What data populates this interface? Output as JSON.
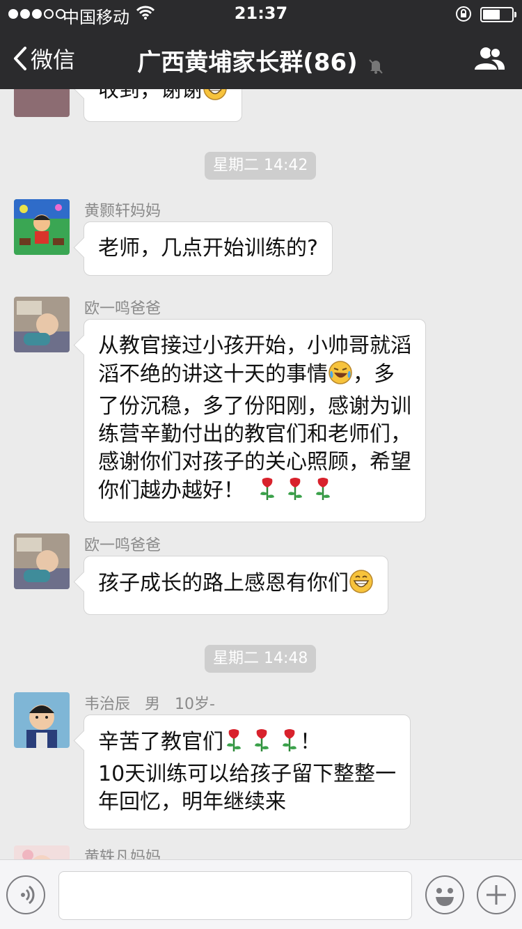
{
  "status_bar": {
    "carrier": "中国移动",
    "time": "21:37",
    "battery_level": 0.6
  },
  "nav": {
    "back_label": "微信",
    "title": "广西黄埔家长群(86)",
    "icons": [
      "back-chevron-icon",
      "mute-bell-icon",
      "group-members-icon"
    ]
  },
  "messages": [
    {
      "type": "text",
      "sender": "",
      "lines": [
        "收到，谢谢"
      ],
      "emoji_end": "grin"
    },
    {
      "type": "time",
      "text": "星期二 14:42"
    },
    {
      "type": "text",
      "sender": "黄颢轩妈妈",
      "lines": [
        "老师，几点开始训练的?"
      ]
    },
    {
      "type": "text",
      "sender": "欧一鸣爸爸",
      "lines": [
        "从教官接过小孩开始，小帅哥就滔",
        "滔不绝的讲这十天的事情",
        "，多",
        "了份沉稳，多了份阳刚，感谢为训",
        "练营辛勤付出的教官们和老师们，",
        "感谢你们对孩子的关心照顾，希望",
        "你们越办越好！"
      ]
    },
    {
      "type": "text",
      "sender": "欧一鸣爸爸",
      "lines": [
        "孩子成长的路上感恩有你们"
      ],
      "emoji_end": "grin"
    },
    {
      "type": "time",
      "text": "星期二 14:48"
    },
    {
      "type": "text",
      "sender": "韦治辰   男   10岁-",
      "lines": [
        "辛苦了教官们",
        "！",
        "10天训练可以给孩子留下整整一",
        "年回忆，明年继续来"
      ]
    },
    {
      "type": "text",
      "sender": "黄轶凡妈妈",
      "lines": []
    }
  ],
  "input_bar": {
    "icons": [
      "voice-icon",
      "emoji-icon",
      "plus-icon"
    ],
    "text": ""
  },
  "colors": {
    "nav_bg": "#2b2b2d",
    "chat_bg": "#ebebeb",
    "time_pill": "#cecece",
    "sender_text": "#8a8a8a"
  }
}
